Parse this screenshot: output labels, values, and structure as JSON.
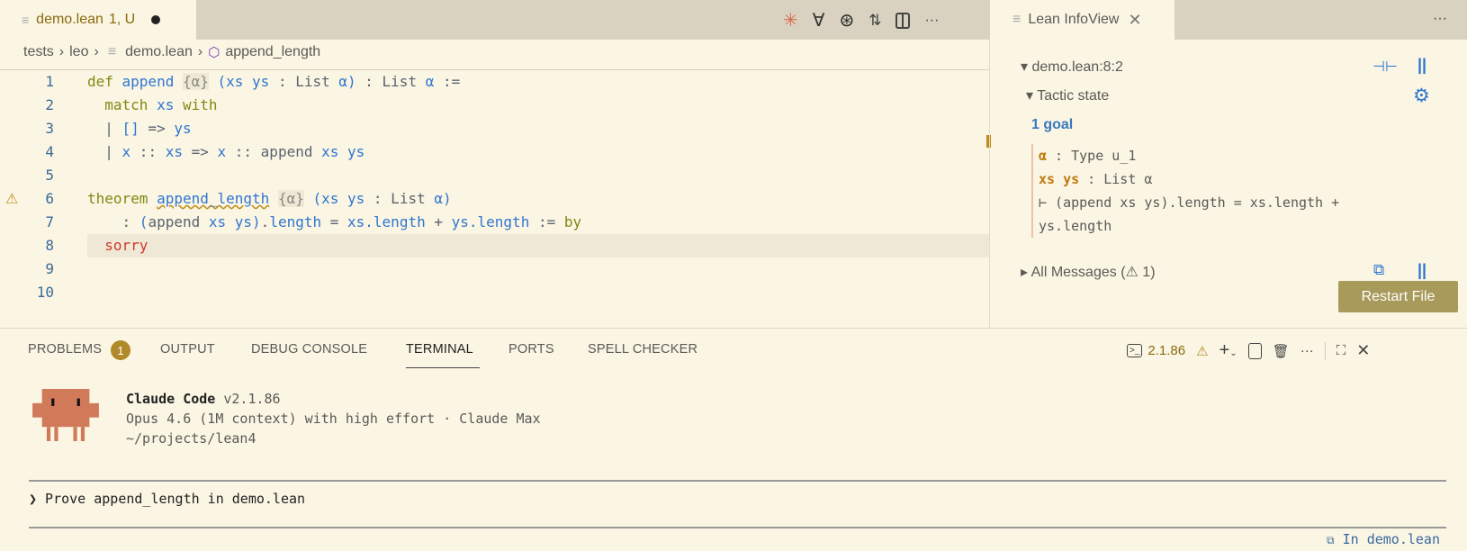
{
  "editor": {
    "tab": {
      "label": "demo.lean",
      "status": "1, U"
    },
    "breadcrumb": [
      "tests",
      "leo",
      "demo.lean",
      "append_length"
    ],
    "lines": [
      {
        "n": "1",
        "tokens": [
          [
            "kw",
            "def "
          ],
          [
            "id",
            "append"
          ],
          [
            "t",
            " "
          ],
          [
            "br",
            "{α}"
          ],
          [
            "t",
            " "
          ],
          [
            "id",
            "(xs ys"
          ],
          [
            "ty",
            " : List "
          ],
          [
            "id",
            "α)"
          ],
          [
            "ty",
            " : List "
          ],
          [
            "id",
            "α"
          ],
          [
            "ty",
            " :="
          ]
        ]
      },
      {
        "n": "2",
        "tokens": [
          [
            "kw",
            "  match "
          ],
          [
            "id",
            "xs "
          ],
          [
            "kw",
            "with"
          ]
        ]
      },
      {
        "n": "3",
        "tokens": [
          [
            "ty",
            "  | "
          ],
          [
            "id",
            "[]"
          ],
          [
            "ty",
            " => "
          ],
          [
            "id",
            "ys"
          ]
        ]
      },
      {
        "n": "4",
        "tokens": [
          [
            "ty",
            "  | "
          ],
          [
            "id",
            "x"
          ],
          [
            "ty",
            " :: "
          ],
          [
            "id",
            "xs"
          ],
          [
            "ty",
            " => "
          ],
          [
            "id",
            "x"
          ],
          [
            "ty",
            " :: append "
          ],
          [
            "id",
            "xs ys"
          ]
        ]
      },
      {
        "n": "5",
        "tokens": []
      },
      {
        "n": "6",
        "tokens": [
          [
            "kw",
            "theorem "
          ],
          [
            "idw",
            "append_length"
          ],
          [
            "t",
            " "
          ],
          [
            "br",
            "{α}"
          ],
          [
            "t",
            " "
          ],
          [
            "id",
            "(xs ys"
          ],
          [
            "ty",
            " : List "
          ],
          [
            "id",
            "α)"
          ]
        ]
      },
      {
        "n": "7",
        "tokens": [
          [
            "ty",
            "    : "
          ],
          [
            "id",
            "("
          ],
          [
            "ty",
            "append "
          ],
          [
            "id",
            "xs ys)"
          ],
          [
            "ty",
            "."
          ],
          [
            "id",
            "length"
          ],
          [
            "ty",
            " = "
          ],
          [
            "id",
            "xs.length"
          ],
          [
            "ty",
            " + "
          ],
          [
            "id",
            "ys.length"
          ],
          [
            "ty",
            " := "
          ],
          [
            "kw",
            "by"
          ]
        ]
      },
      {
        "n": "8",
        "tokens": [
          [
            "er",
            "  sorry"
          ]
        ]
      },
      {
        "n": "9",
        "tokens": []
      },
      {
        "n": "10",
        "tokens": []
      }
    ]
  },
  "infoview": {
    "tab_label": "Lean InfoView",
    "location": "demo.lean:8:2",
    "tactic_state": "Tactic state",
    "goal_count": "1 goal",
    "hyps": [
      {
        "name": "α",
        "type": " : Type u_1"
      },
      {
        "name": "xs ys",
        "type": " : List α"
      }
    ],
    "goal_line1": "⊢ (append xs ys).length = xs.length +",
    "goal_line2": "ys.length",
    "all_messages": "All Messages (⚠ 1)",
    "restart_button": "Restart File"
  },
  "panel": {
    "tabs": [
      "PROBLEMS",
      "OUTPUT",
      "DEBUG CONSOLE",
      "TERMINAL",
      "PORTS",
      "SPELL CHECKER"
    ],
    "problems_badge": "1",
    "terminal_label": "2.1.86"
  },
  "terminal": {
    "app_name": "Claude Code",
    "version": "v2.1.86",
    "model_line": "Opus 4.6 (1M context) with high effort · Claude Max",
    "cwd": "~/projects/lean4",
    "prompt": "❯ Prove append_length in demo.lean",
    "context": "In demo.lean"
  },
  "colors": {
    "accent": "#a89a5a",
    "badge": "#b08a2a",
    "claude": "#d07a5a"
  }
}
